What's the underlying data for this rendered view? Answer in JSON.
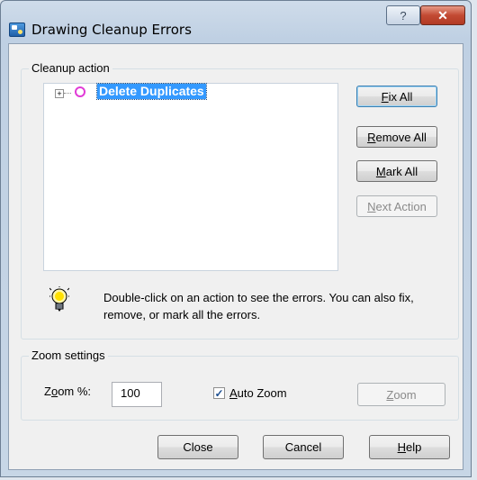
{
  "window": {
    "title": "Drawing Cleanup Errors",
    "help_button": "?",
    "close_button": "✕"
  },
  "cleanup": {
    "group_label": "Cleanup action",
    "tree": {
      "expander": "+",
      "node_label": "Delete Duplicates"
    },
    "buttons": {
      "fix_all": {
        "pre": "",
        "ul": "F",
        "post": "ix All"
      },
      "remove_all": {
        "pre": "",
        "ul": "R",
        "post": "emove All"
      },
      "mark_all": {
        "pre": "",
        "ul": "M",
        "post": "ark All"
      },
      "next_action": {
        "pre": "",
        "ul": "N",
        "post": "ext Action"
      }
    },
    "hint": "Double-click on an action to see the errors. You can also fix, remove, or mark all the errors."
  },
  "zoom": {
    "group_label": "Zoom settings",
    "label": {
      "pre": "Z",
      "ul": "o",
      "post": "om %:"
    },
    "value": "100",
    "auto_zoom": {
      "pre": "",
      "ul": "A",
      "post": "uto Zoom",
      "checked": true
    },
    "zoom_button": {
      "pre": "",
      "ul": "Z",
      "post": "oom"
    }
  },
  "footer": {
    "close": "Close",
    "cancel": "Cancel",
    "help": {
      "pre": "",
      "ul": "H",
      "post": "elp"
    }
  },
  "colors": {
    "selection": "#3399ff",
    "node_circle": "#e13bd7"
  }
}
